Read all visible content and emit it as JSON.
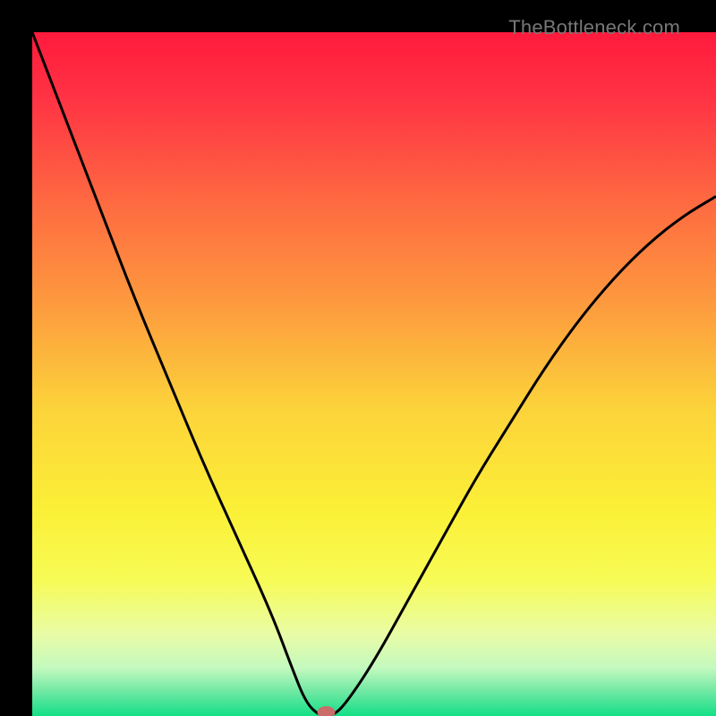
{
  "watermark": "TheBottleneck.com",
  "chart_data": {
    "type": "line",
    "title": "",
    "xlabel": "",
    "ylabel": "",
    "xlim": [
      0,
      100
    ],
    "ylim": [
      0,
      100
    ],
    "series": [
      {
        "name": "bottleneck-curve",
        "color": "#000000",
        "x": [
          0,
          5,
          10,
          15,
          20,
          25,
          30,
          35,
          38,
          40,
          42,
          44,
          46,
          50,
          55,
          60,
          65,
          70,
          75,
          80,
          85,
          90,
          95,
          100
        ],
        "y": [
          100,
          87,
          74,
          61,
          49,
          37,
          26,
          15,
          7,
          2,
          0,
          0,
          2,
          8,
          17,
          26,
          35,
          43,
          51,
          58,
          64,
          69,
          73,
          76
        ]
      }
    ],
    "marker": {
      "name": "optimal-point",
      "x": 43,
      "y": 0,
      "color": "#c96c6a"
    },
    "gradient_stops": [
      {
        "offset": 0.0,
        "color": "#ff1a3c"
      },
      {
        "offset": 0.1,
        "color": "#ff3444"
      },
      {
        "offset": 0.25,
        "color": "#fe6a41"
      },
      {
        "offset": 0.4,
        "color": "#fd9b3e"
      },
      {
        "offset": 0.55,
        "color": "#fcd33a"
      },
      {
        "offset": 0.7,
        "color": "#fbf037"
      },
      {
        "offset": 0.8,
        "color": "#f7fb55"
      },
      {
        "offset": 0.88,
        "color": "#e9fca6"
      },
      {
        "offset": 0.93,
        "color": "#c3f9bf"
      },
      {
        "offset": 0.965,
        "color": "#6de8a2"
      },
      {
        "offset": 1.0,
        "color": "#14df87"
      }
    ]
  }
}
